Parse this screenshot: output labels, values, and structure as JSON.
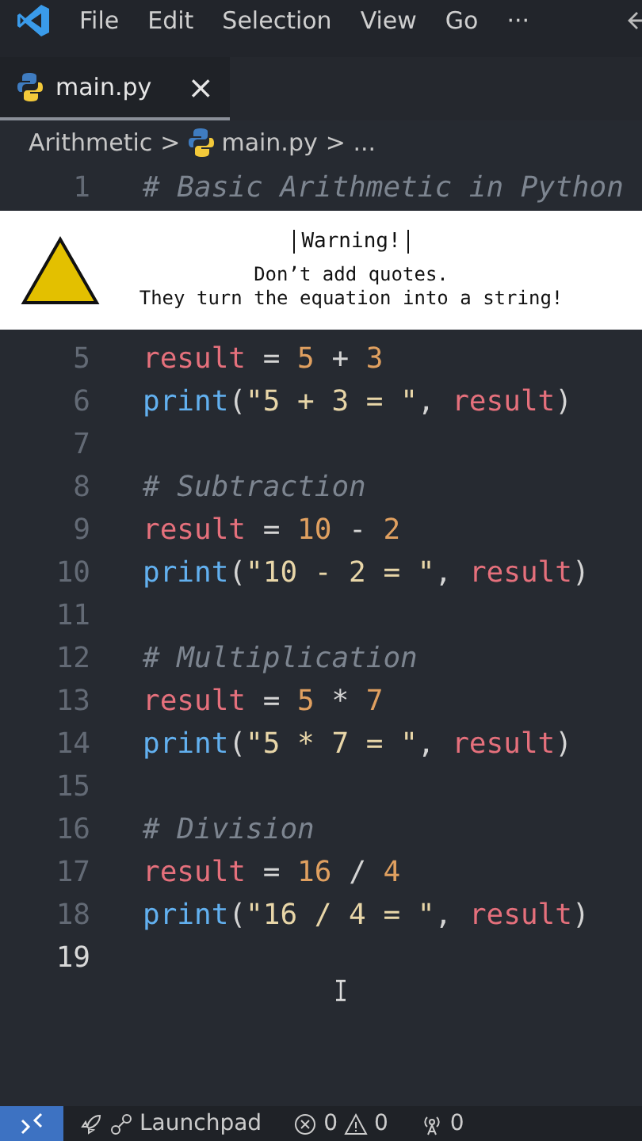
{
  "menu": [
    "File",
    "Edit",
    "Selection",
    "View",
    "Go",
    "···"
  ],
  "tabs": [
    {
      "label": "main.py",
      "close": "×",
      "selected": true
    }
  ],
  "breadcrumb": [
    "Arithmetic",
    ">",
    "main.py",
    "> ..."
  ],
  "code": [
    {
      "number": "1",
      "tokens": [
        {
          "kind": "comment",
          "text": "# Basic Arithmetic in Python"
        }
      ]
    },
    {
      "kind": "warning",
      "title": "Warning!",
      "lines": [
        "Don’t add quotes.",
        "They turn the equation into a string!"
      ]
    },
    {
      "number": "5",
      "tokens": [
        {
          "kind": "var",
          "text": "result"
        },
        {
          "kind": "op",
          "text": " = "
        },
        {
          "kind": "num",
          "text": "5"
        },
        {
          "kind": "op",
          "text": " + "
        },
        {
          "kind": "num",
          "text": "3"
        }
      ]
    },
    {
      "number": "6",
      "tokens": [
        {
          "kind": "func",
          "text": "print"
        },
        {
          "kind": "op",
          "text": "("
        },
        {
          "kind": "str",
          "text": "\"5 + 3 = \""
        },
        {
          "kind": "op",
          "text": ", "
        },
        {
          "kind": "var",
          "text": "result"
        },
        {
          "kind": "op",
          "text": ")"
        }
      ]
    },
    {
      "number": "7"
    },
    {
      "number": "8",
      "tokens": [
        {
          "kind": "comment",
          "text": "# Subtraction"
        }
      ]
    },
    {
      "number": "9",
      "tokens": [
        {
          "kind": "var",
          "text": "result"
        },
        {
          "kind": "op",
          "text": " = "
        },
        {
          "kind": "num",
          "text": "10"
        },
        {
          "kind": "op",
          "text": " - "
        },
        {
          "kind": "num",
          "text": "2"
        }
      ]
    },
    {
      "number": "10",
      "tokens": [
        {
          "kind": "func",
          "text": "print"
        },
        {
          "kind": "op",
          "text": "("
        },
        {
          "kind": "str",
          "text": "\"10 - 2 = \""
        },
        {
          "kind": "op",
          "text": ", "
        },
        {
          "kind": "var",
          "text": "result"
        },
        {
          "kind": "op",
          "text": ")"
        }
      ]
    },
    {
      "number": "11"
    },
    {
      "number": "12",
      "tokens": [
        {
          "kind": "comment",
          "text": "# Multiplication"
        }
      ]
    },
    {
      "number": "13",
      "tokens": [
        {
          "kind": "var",
          "text": "result"
        },
        {
          "kind": "op",
          "text": " = "
        },
        {
          "kind": "num",
          "text": "5"
        },
        {
          "kind": "op",
          "text": " * "
        },
        {
          "kind": "num",
          "text": "7"
        }
      ]
    },
    {
      "number": "14",
      "tokens": [
        {
          "kind": "func",
          "text": "print"
        },
        {
          "kind": "op",
          "text": "("
        },
        {
          "kind": "str",
          "text": "\"5 * 7 = \""
        },
        {
          "kind": "op",
          "text": ", "
        },
        {
          "kind": "var",
          "text": "result"
        },
        {
          "kind": "op",
          "text": ")"
        }
      ]
    },
    {
      "number": "15"
    },
    {
      "number": "16",
      "tokens": [
        {
          "kind": "comment",
          "text": "# Division"
        }
      ]
    },
    {
      "number": "17",
      "tokens": [
        {
          "kind": "var",
          "text": "result"
        },
        {
          "kind": "op",
          "text": " = "
        },
        {
          "kind": "num",
          "text": "16"
        },
        {
          "kind": "op",
          "text": " / "
        },
        {
          "kind": "num",
          "text": "4"
        }
      ]
    },
    {
      "number": "18",
      "tokens": [
        {
          "kind": "func",
          "text": "print"
        },
        {
          "kind": "op",
          "text": "("
        },
        {
          "kind": "str",
          "text": "\"16 / 4 = \""
        },
        {
          "kind": "op",
          "text": ", "
        },
        {
          "kind": "var",
          "text": "result"
        },
        {
          "kind": "op",
          "text": ")"
        }
      ]
    },
    {
      "number": "19",
      "current": true
    }
  ],
  "status_bar": {
    "launchpad": "Launchpad",
    "errors": "0",
    "warnings": "0",
    "ports": "0"
  }
}
